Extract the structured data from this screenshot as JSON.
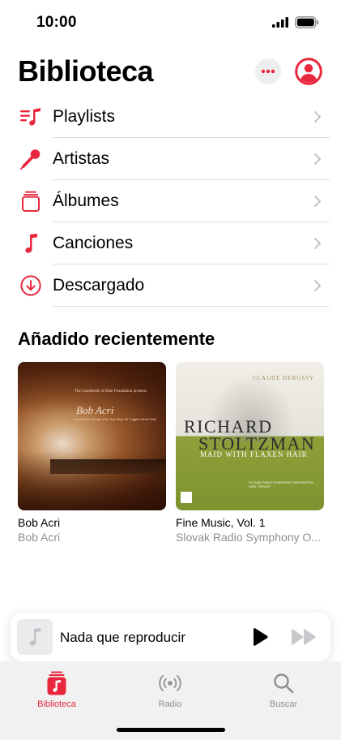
{
  "status": {
    "time": "10:00"
  },
  "header": {
    "title": "Biblioteca"
  },
  "library": {
    "items": [
      {
        "label": "Playlists",
        "icon": "playlists-icon"
      },
      {
        "label": "Artistas",
        "icon": "microphone-icon"
      },
      {
        "label": "Álbumes",
        "icon": "albums-icon"
      },
      {
        "label": "Canciones",
        "icon": "music-note-icon"
      },
      {
        "label": "Descargado",
        "icon": "download-icon"
      }
    ]
  },
  "recent": {
    "title": "Añadido recientemente",
    "albums": [
      {
        "title": "Bob Acri",
        "artist": "Bob Acri",
        "cover_text": {
          "line1": "The Candleside of Blue Foundation presents",
          "name": "Bob Acri",
          "tracks": "Dora Dells Lounge  Miss Say Sibyl  Sit Triggers  Book Ride"
        }
      },
      {
        "title": "Fine Music, Vol. 1",
        "artist": "Slovak Radio Symphony O...",
        "cover_text": {
          "composer": "CLAUDE DEBUSSY",
          "first": "RICHARD",
          "last": "STOLTZMAN",
          "subtitle": "MAID WITH FLAXEN HAIR",
          "orchestra": "SLOVAK RADIO SYMPHONY ORCHESTRA",
          "conductor": "KIRK TREVOR"
        }
      }
    ]
  },
  "player": {
    "title": "Nada que reproducir"
  },
  "tabs": [
    {
      "label": "Biblioteca",
      "active": true
    },
    {
      "label": "Radio",
      "active": false
    },
    {
      "label": "Buscar",
      "active": false
    }
  ],
  "colors": {
    "accent": "#e8273f",
    "secondary_text": "#8e8e93"
  }
}
